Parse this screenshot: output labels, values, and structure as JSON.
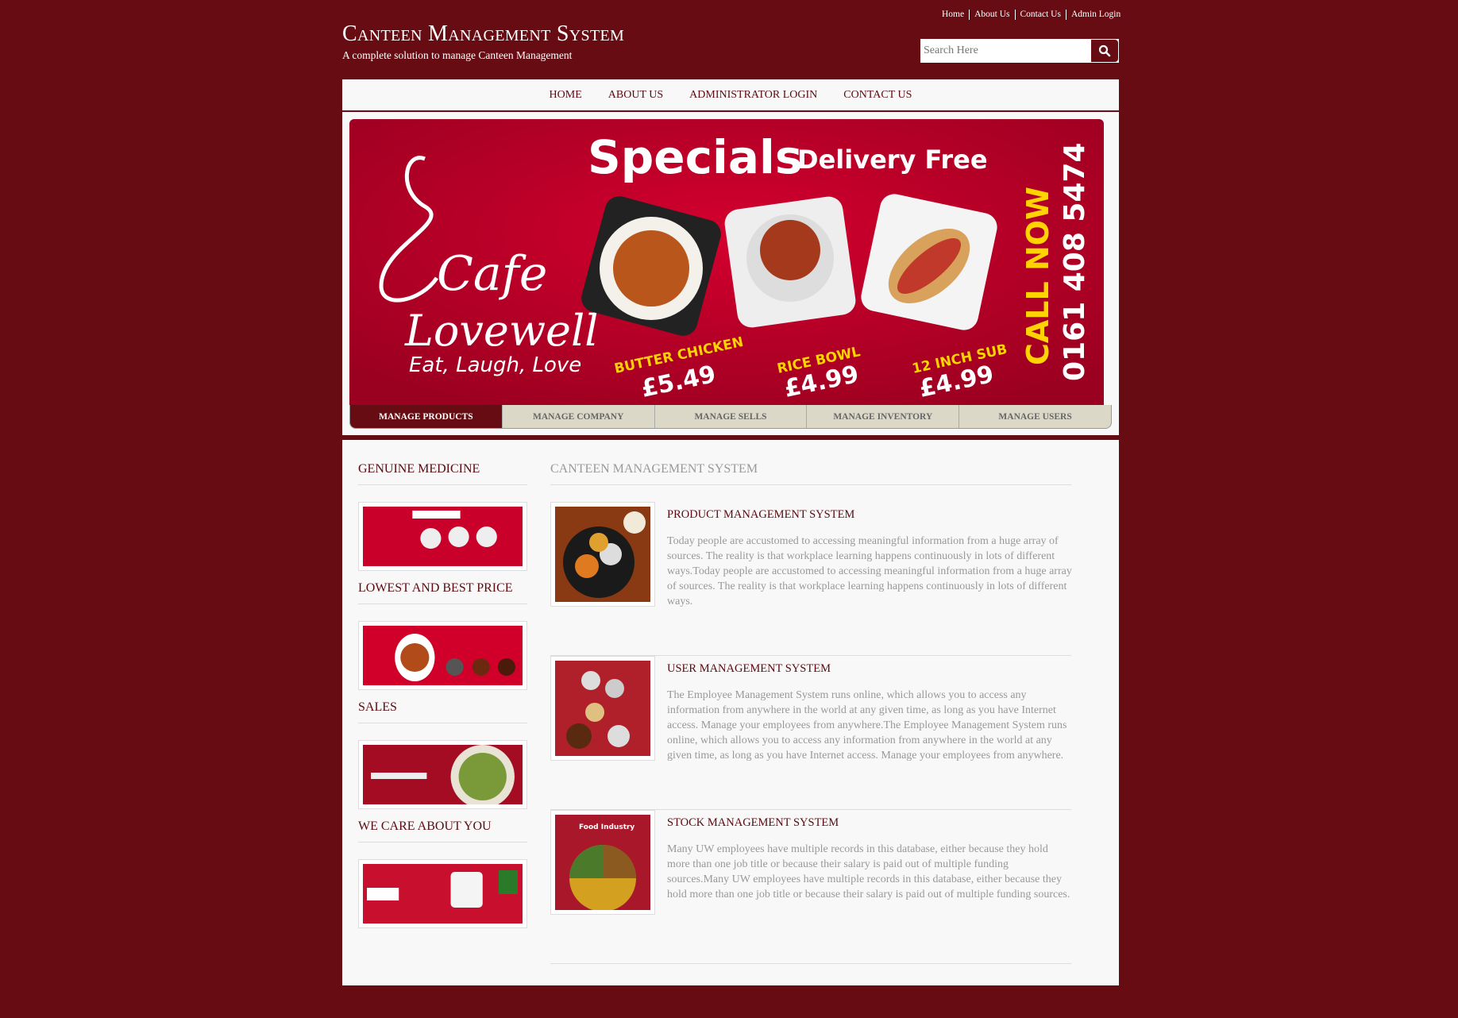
{
  "header": {
    "top_links": [
      "Home",
      "About Us",
      "Contact Us",
      "Admin Login"
    ],
    "title": "Canteen Management System",
    "subtitle": "A complete solution to manage Canteen Management",
    "search": {
      "placeholder": "Search Here",
      "icon": "search-icon"
    }
  },
  "nav": [
    "HOME",
    "ABOUT US",
    "ADMINISTRATOR LOGIN",
    "CONTACT US"
  ],
  "banner": {
    "headline": "Specials",
    "tagline": "Delivery Free",
    "brand": "Cafe",
    "brand2": "Lovewell",
    "motto": "Eat, Laugh, Love",
    "items": [
      {
        "name": "BUTTER CHICKEN",
        "price": "£5.49"
      },
      {
        "name": "RICE BOWL",
        "price": "£4.99"
      },
      {
        "name": "12 INCH SUB",
        "price": "£4.99"
      }
    ],
    "call": "CALL NOW",
    "phone": "0161 408 5474"
  },
  "tabs": {
    "items": [
      "MANAGE PRODUCTS",
      "MANAGE COMPANY",
      "MANAGE SELLS",
      "MANAGE INVENTORY",
      "MANAGE USERS"
    ],
    "active": 0
  },
  "sidebar": [
    {
      "heading": "GENUINE MEDICINE"
    },
    {
      "heading": "LOWEST AND BEST PRICE"
    },
    {
      "heading": "SALES"
    },
    {
      "heading": "WE CARE ABOUT YOU"
    }
  ],
  "main": {
    "heading": "CANTEEN MANAGEMENT SYSTEM",
    "articles": [
      {
        "title": "PRODUCT MANAGEMENT SYSTEM",
        "text": "Today people are accustomed to accessing meaningful information from a huge array of sources. The reality is that workplace learning happens continuously in lots of different ways.Today people are accustomed to accessing meaningful information from a huge array of sources. The reality is that workplace learning happens continuously in lots of different ways."
      },
      {
        "title": "USER MANAGEMENT SYSTEM",
        "text": "The Employee Management System runs online, which allows you to access any information from anywhere in the world at any given time, as long as you have Internet access. Manage your employees from anywhere.The Employee Management System runs online, which allows you to access any information from anywhere in the world at any given time, as long as you have Internet access. Manage your employees from anywhere."
      },
      {
        "title": "STOCK MANAGEMENT SYSTEM",
        "text": "Many UW employees have multiple records in this database, either because they hold more than one job title or because their salary is paid out of multiple funding sources.Many UW employees have multiple records in this database, either because they hold more than one job title or because their salary is paid out of multiple funding sources."
      }
    ],
    "thumb3_label": "Food Industry"
  },
  "colors": {
    "background": "#680c13",
    "accent": "#5a0a10",
    "banner": "#c8002a",
    "tab_bg": "#dcd8c8"
  }
}
